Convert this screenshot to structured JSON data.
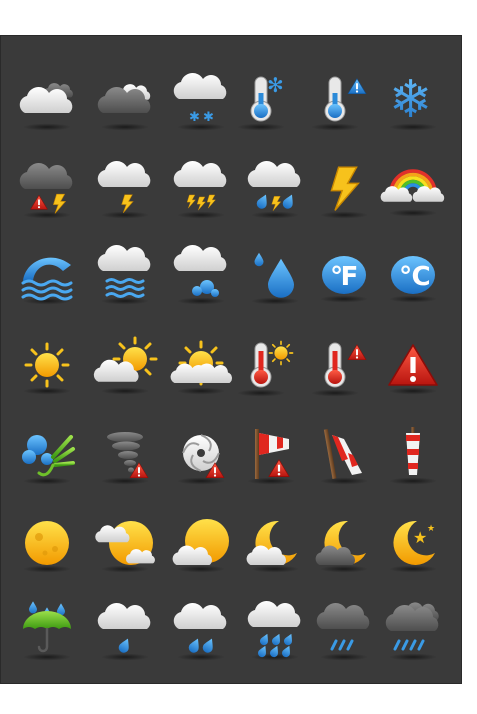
{
  "colors": {
    "background": "#3a3a3a",
    "page": "#ffffff",
    "cloud": "#f2f2f2",
    "dark_cloud": "#6e6e6e",
    "sun": "#f7c21c",
    "moon": "#f2c01e",
    "alert": "#e0271f",
    "lightning": "#f7c21c",
    "water": "#2b8ad8",
    "snow": "#3a9be6"
  },
  "grid": {
    "rows": [
      [
        "cloud-with-small-cloud-icon",
        "dark-cloud-icon",
        "snow-cloud-icon",
        "thermometer-cold-icon",
        "thermometer-cold-alert-icon",
        "snowflake-icon"
      ],
      [
        "storm-alert-cloud-icon",
        "thunder-cloud-icon",
        "thunderstorm-icon",
        "thunder-rain-cloud-icon",
        "lightning-bolt-icon",
        "rainbow-icon"
      ],
      [
        "wave-wind-icon",
        "fog-icon",
        "wind-cloud-icon",
        "water-drops-icon",
        "fahrenheit-badge-icon",
        "celsius-badge-icon"
      ],
      [
        "sun-icon",
        "partly-sunny-icon",
        "sunrise-cloud-icon",
        "thermometer-hot-icon",
        "thermometer-hot-alert-icon",
        "warning-icon"
      ],
      [
        "wind-blowing-icon",
        "tornado-alert-icon",
        "hurricane-alert-icon",
        "windsock-alert-icon",
        "windsock-icon",
        "small-windsock-icon"
      ],
      [
        "full-moon-icon",
        "moon-behind-cloud-icon",
        "moon-cloud-icon",
        "crescent-cloud-icon",
        "crescent-dark-cloud-icon",
        "crescent-star-icon"
      ],
      [
        "umbrella-rain-icon",
        "light-rain-icon",
        "rain-icon",
        "heavy-rain-icon",
        "dark-rain-icon",
        "dark-heavy-rain-icon"
      ]
    ]
  }
}
